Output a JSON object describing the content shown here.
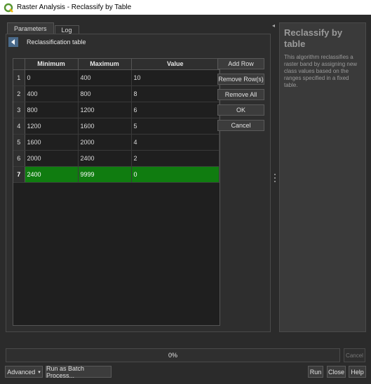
{
  "window": {
    "title": "Raster Analysis - Reclassify by Table"
  },
  "tabs": [
    {
      "label": "Parameters",
      "active": true
    },
    {
      "label": "Log",
      "active": false
    }
  ],
  "params": {
    "section_title": "Reclassification table",
    "table": {
      "columns": [
        "Minimum",
        "Maximum",
        "Value"
      ],
      "rows": [
        {
          "num": "1",
          "min": "0",
          "max": "400",
          "value": "10"
        },
        {
          "num": "2",
          "min": "400",
          "max": "800",
          "value": "8"
        },
        {
          "num": "3",
          "min": "800",
          "max": "1200",
          "value": "6"
        },
        {
          "num": "4",
          "min": "1200",
          "max": "1600",
          "value": "5"
        },
        {
          "num": "5",
          "min": "1600",
          "max": "2000",
          "value": "4"
        },
        {
          "num": "6",
          "min": "2000",
          "max": "2400",
          "value": "2"
        },
        {
          "num": "7",
          "min": "2400",
          "max": "9999",
          "value": "0"
        }
      ],
      "selected_row": 7
    },
    "buttons": {
      "add_row": "Add Row",
      "remove_rows": "Remove Row(s)",
      "remove_all": "Remove All",
      "ok": "OK",
      "cancel": "Cancel"
    }
  },
  "help": {
    "title": "Reclassify by table",
    "text": "This algorithm reclassifies a raster band by assigning new class values based on the ranges specified in a fixed table."
  },
  "progress": {
    "percent": 0,
    "label": "0%",
    "cancel_label": "Cancel"
  },
  "footer": {
    "advanced": "Advanced",
    "batch": "Run as Batch Process...",
    "run": "Run",
    "close": "Close",
    "help": "Help"
  },
  "colors": {
    "selected_row": "#107c10",
    "background": "#2b2b2b",
    "qgis_green": "#589632"
  }
}
